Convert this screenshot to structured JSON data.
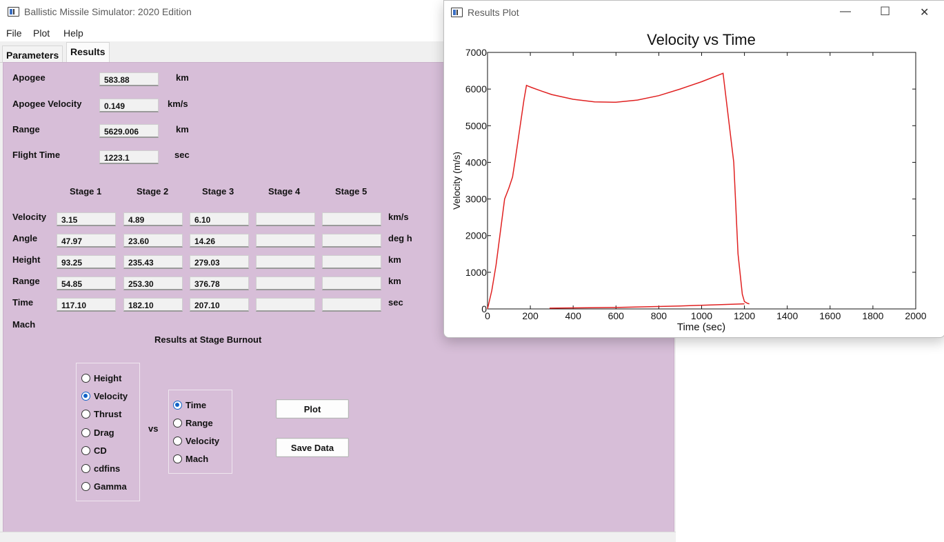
{
  "main": {
    "title": "Ballistic Missile Simulator: 2020 Edition",
    "menu": [
      "File",
      "Plot",
      "Help"
    ],
    "tabs": [
      "Parameters",
      "Results"
    ],
    "summary": [
      {
        "label": "Apogee",
        "value": "583.88",
        "unit": "km"
      },
      {
        "label": "Apogee Velocity",
        "value": "0.149",
        "unit": "km/s"
      },
      {
        "label": "Range",
        "value": "5629.006",
        "unit": "km"
      },
      {
        "label": "Flight Time",
        "value": "1223.1",
        "unit": "sec"
      }
    ],
    "stage_headers": [
      "Stage 1",
      "Stage 2",
      "Stage 3",
      "Stage 4",
      "Stage 5"
    ],
    "rows": [
      {
        "label": "Velocity",
        "unit": "km/s",
        "values": [
          "3.15",
          "4.89",
          "6.10",
          "",
          ""
        ]
      },
      {
        "label": "Angle",
        "unit": "deg h",
        "values": [
          "47.97",
          "23.60",
          "14.26",
          "",
          ""
        ]
      },
      {
        "label": "Height",
        "unit": "km",
        "values": [
          "93.25",
          "235.43",
          "279.03",
          "",
          ""
        ]
      },
      {
        "label": "Range",
        "unit": "km",
        "values": [
          "54.85",
          "253.30",
          "376.78",
          "",
          ""
        ]
      },
      {
        "label": "Time",
        "unit": "sec",
        "values": [
          "117.10",
          "182.10",
          "207.10",
          "",
          ""
        ]
      }
    ],
    "mach_label": "Mach",
    "burnout_caption": "Results at Stage Burnout",
    "y_options": [
      "Height",
      "Velocity",
      "Thrust",
      "Drag",
      "CD",
      "cdfins",
      "Gamma"
    ],
    "y_selected": "Velocity",
    "vs_label": "vs",
    "x_options": [
      "Time",
      "Range",
      "Velocity",
      "Mach"
    ],
    "x_selected": "Time",
    "plot_button": "Plot",
    "save_button": "Save Data"
  },
  "plot_window": {
    "title": "Results Plot",
    "controls": {
      "minimize": "—",
      "maximize": "☐",
      "close": "✕"
    }
  },
  "chart_data": {
    "type": "line",
    "title": "Velocity vs Time",
    "xlabel": "Time (sec)",
    "ylabel": "Velocity (m/s)",
    "xlim": [
      0,
      2000
    ],
    "ylim": [
      0,
      7000
    ],
    "xticks": [
      0,
      200,
      400,
      600,
      800,
      1000,
      1200,
      1400,
      1600,
      1800,
      2000
    ],
    "yticks": [
      0,
      1000,
      2000,
      3000,
      4000,
      5000,
      6000,
      7000
    ],
    "grid": false,
    "color": "#e02020",
    "series": [
      {
        "x": [
          0,
          20,
          40,
          60,
          80,
          90,
          100,
          117,
          130,
          150,
          170,
          182,
          190,
          207,
          250,
          300,
          400,
          500,
          600,
          700,
          800,
          900,
          1000,
          1100,
          1150,
          1170,
          1190,
          1200,
          1215,
          1223
        ],
        "y": [
          0,
          500,
          1200,
          2100,
          3000,
          3150,
          3300,
          3600,
          4100,
          4900,
          5700,
          6100,
          6080,
          6040,
          5950,
          5850,
          5720,
          5650,
          5640,
          5700,
          5820,
          6000,
          6200,
          6430,
          4000,
          1500,
          400,
          200,
          150,
          140
        ]
      },
      {
        "x": [
          290,
          600,
          900,
          1200
        ],
        "y": [
          20,
          40,
          80,
          140
        ]
      }
    ]
  }
}
